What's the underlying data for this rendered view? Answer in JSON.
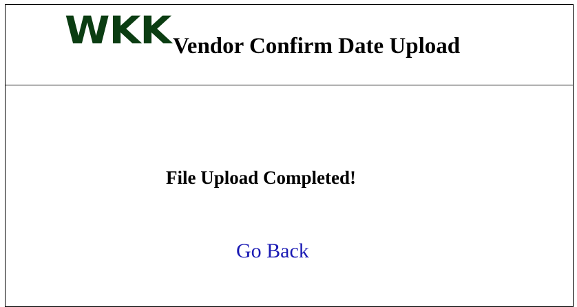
{
  "header": {
    "logo_text": "WKK",
    "title": "Vendor Confirm Date Upload"
  },
  "main": {
    "status_message": "File Upload Completed!",
    "go_back_label": "Go Back"
  },
  "colors": {
    "logo": "#0b3d12",
    "link": "#1a1ab4",
    "divider": "#666666"
  }
}
